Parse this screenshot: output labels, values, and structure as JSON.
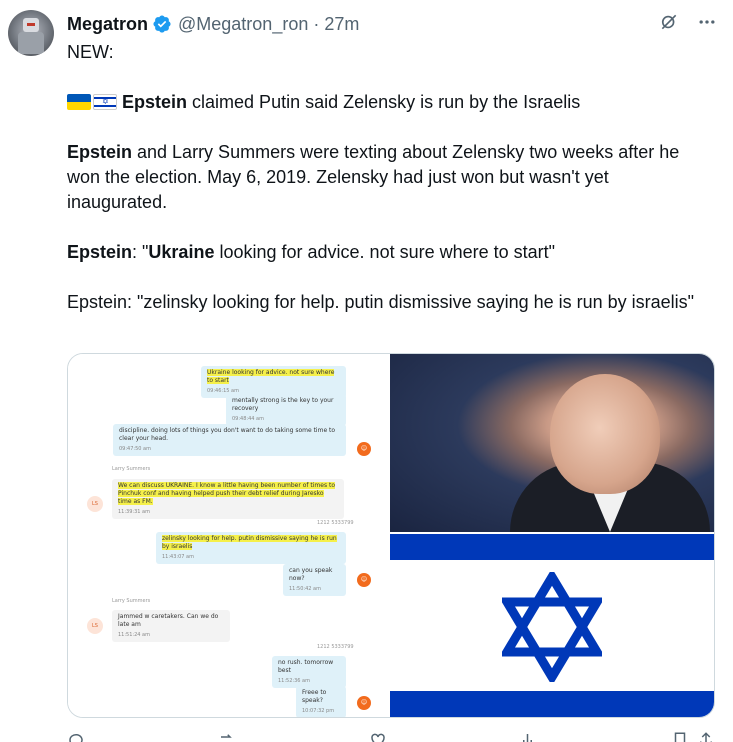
{
  "author": {
    "name": "Megatron",
    "handle": "@Megatron_ron",
    "separator": "·",
    "time": "27m"
  },
  "tweet": {
    "line1": "NEW:",
    "headline_bold": "Epstein",
    "headline_rest": " claimed Putin said Zelensky is run by the Israelis",
    "para2_bold": "Epstein",
    "para2_rest": " and Larry Summers were texting about Zelensky two weeks after he won the election. May 6, 2019. Zelensky had just won but wasn't yet inaugurated.",
    "para3_bold1": "Epstein",
    "para3_mid": ": \"",
    "para3_bold2": "Ukraine",
    "para3_rest": " looking for advice. not sure where to start\"",
    "para4": "Epstein: \"zelinsky looking for help. putin dismissive saying he is run by israelis\""
  },
  "chat": {
    "top_meta": "— —— ——",
    "m1_text": "Ukraine  looking for advice.    not sure where to start",
    "m1_ts": "09:46:15 am",
    "m2_text": "mentally strong is the key  to your recovery",
    "m2_ts": "09:48:44 am",
    "m3_text": "discipline. doing lots of things you don't want to do   taking some time to clear your head.",
    "m3_ts": "09:47:50 am",
    "sender_ls": "Larry Summers",
    "m4_text": "We can discuss UKRAINE. I know a little having been number of times to Pinchuk conf and having helped push their debt relief during Jaresko time as FM.",
    "m4_ts": "11:39:31 am",
    "num1": "1212 5333799",
    "m5_text": "zelinsky looking for help.   putin dismissive  saying he is run by israelis",
    "m5_ts": "11:43:07 am",
    "m6_text": "can you speak now?",
    "m6_ts": "11:50:42 am",
    "sender_ls2": "Larry Summers",
    "m7_text": "Jammed w caretakers. Can we do late am",
    "m7_ts": "11:51:24 am",
    "num2": "1212 5333799",
    "m8_text": "no rush.   tomorrow best",
    "m8_ts": "11:52:36 am",
    "m9_text": "Freee to speak?",
    "m9_ts": "10:07:32 pm",
    "ls_initials": "LS"
  },
  "icons": {
    "verified": "verified-badge-icon",
    "grok": "grok-icon",
    "more": "more-icon"
  },
  "colors": {
    "verified_blue": "#1d9bf0",
    "text": "#0f1419",
    "secondary": "#536471",
    "border": "#cfd9de"
  }
}
